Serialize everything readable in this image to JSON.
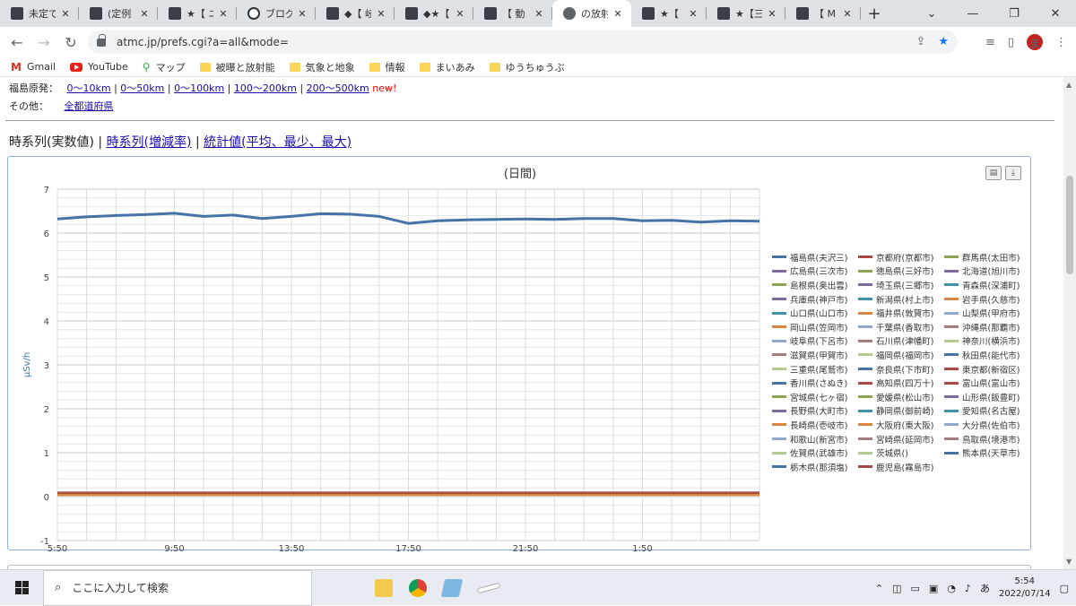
{
  "browser": {
    "tabs": [
      {
        "title": "未定で",
        "icon": "site-favicon"
      },
      {
        "title": "(定例",
        "icon": "site-favicon"
      },
      {
        "title": "★【 ニ",
        "icon": "site-favicon"
      },
      {
        "title": "ブログ記",
        "icon": "info-icon"
      },
      {
        "title": "◆【 岐",
        "icon": "site-favicon"
      },
      {
        "title": "◆★【",
        "icon": "site-favicon"
      },
      {
        "title": "【 動",
        "icon": "site-favicon"
      },
      {
        "title": "の放射",
        "icon": "globe-icon",
        "active": true
      },
      {
        "title": "★【 ",
        "icon": "site-favicon"
      },
      {
        "title": "★【三",
        "icon": "site-favicon"
      },
      {
        "title": "【 M",
        "icon": "site-favicon"
      }
    ],
    "new_tab": "+",
    "url": "atmc.jp/prefs.cgi?a=all&mode=",
    "avatar_letter": "ま",
    "bookmarks": [
      {
        "label": "Gmail",
        "icon": "gmail-icon"
      },
      {
        "label": "YouTube",
        "icon": "youtube-icon"
      },
      {
        "label": "マップ",
        "icon": "maps-icon"
      },
      {
        "label": "被曝と放射能",
        "icon": "folder-icon"
      },
      {
        "label": "気象と地象",
        "icon": "folder-icon"
      },
      {
        "label": "情報",
        "icon": "folder-icon"
      },
      {
        "label": "まいあみ",
        "icon": "folder-icon"
      },
      {
        "label": "ゆうちゅうぶ",
        "icon": "folder-icon"
      }
    ]
  },
  "page": {
    "fukushima_label": "福島原発：",
    "distance_links": [
      "0〜10km",
      "0〜50km",
      "0〜100km",
      "100〜200km",
      "200〜500km"
    ],
    "new_badge": "new!",
    "other_label": "その他：",
    "all_prefs_link": "全都道府県",
    "view_current": "時系列(実数値)",
    "view_links": [
      "時系列(増減率)",
      "統計値(平均、最少、最大)"
    ],
    "separator": "|"
  },
  "chart_data": {
    "type": "line",
    "title": "(日間)",
    "ylabel": "μSv/h",
    "ylim": [
      -1,
      7
    ],
    "yticks": [
      -1,
      0,
      1,
      2,
      3,
      4,
      5,
      6,
      7
    ],
    "xtick_labels": [
      "5:50",
      "9:50",
      "13:50",
      "17:50",
      "21:50",
      "1:50"
    ],
    "x": [
      "5:50",
      "6:50",
      "7:50",
      "8:50",
      "9:50",
      "10:50",
      "11:50",
      "12:50",
      "13:50",
      "14:50",
      "15:50",
      "16:50",
      "17:50",
      "18:50",
      "19:50",
      "20:50",
      "21:50",
      "22:50",
      "23:50",
      "0:50",
      "1:50",
      "2:50",
      "3:50",
      "4:50",
      "5:30"
    ],
    "series": [
      {
        "name": "福島県(夫沢三)",
        "color": "#4572a7",
        "values": [
          6.32,
          6.37,
          6.4,
          6.42,
          6.45,
          6.38,
          6.41,
          6.33,
          6.38,
          6.44,
          6.43,
          6.38,
          6.22,
          6.28,
          6.3,
          6.31,
          6.32,
          6.31,
          6.33,
          6.33,
          6.28,
          6.29,
          6.25,
          6.28,
          6.27
        ]
      },
      {
        "name": "京都府(京都市)",
        "color": "#aa4643",
        "values": [
          0.05,
          0.05,
          0.05,
          0.05,
          0.05,
          0.05,
          0.05,
          0.05,
          0.05,
          0.05,
          0.05,
          0.05,
          0.05,
          0.05,
          0.05,
          0.05,
          0.05,
          0.05,
          0.05,
          0.05,
          0.05,
          0.05,
          0.05,
          0.05,
          0.05
        ]
      },
      {
        "name": "群馬県(太田市)",
        "color": "#89a54e",
        "values": [
          0.06,
          0.06,
          0.06,
          0.06,
          0.06,
          0.06,
          0.06,
          0.06,
          0.06,
          0.06,
          0.06,
          0.06,
          0.06,
          0.06,
          0.06,
          0.06,
          0.06,
          0.06,
          0.06,
          0.06,
          0.06,
          0.06,
          0.06,
          0.06,
          0.06
        ]
      },
      {
        "name": "広島県(三次市)",
        "color": "#80699b",
        "values": [
          0.07,
          0.07,
          0.07,
          0.07,
          0.07,
          0.07,
          0.07,
          0.07,
          0.07,
          0.07,
          0.07,
          0.07,
          0.07,
          0.07,
          0.07,
          0.07,
          0.07,
          0.07,
          0.07,
          0.07,
          0.07,
          0.07,
          0.07,
          0.07,
          0.07
        ]
      },
      {
        "name": "徳島県(三好市)",
        "color": "#3d96ae",
        "values": [
          0.08,
          0.08,
          0.08,
          0.08,
          0.08,
          0.08,
          0.08,
          0.08,
          0.08,
          0.08,
          0.08,
          0.08,
          0.08,
          0.08,
          0.08,
          0.08,
          0.08,
          0.08,
          0.08,
          0.08,
          0.08,
          0.08,
          0.08,
          0.08,
          0.08
        ]
      },
      {
        "name": "北海道(旭川市)",
        "color": "#db843d",
        "values": [
          0.04,
          0.04,
          0.04,
          0.04,
          0.04,
          0.04,
          0.04,
          0.04,
          0.04,
          0.04,
          0.04,
          0.04,
          0.04,
          0.04,
          0.04,
          0.04,
          0.04,
          0.04,
          0.04,
          0.04,
          0.04,
          0.04,
          0.04,
          0.04,
          0.04
        ]
      },
      {
        "name": "鹿児島(霧島市)",
        "color": "#a74b3c",
        "values": [
          0.09,
          0.09,
          0.09,
          0.09,
          0.09,
          0.09,
          0.09,
          0.09,
          0.09,
          0.09,
          0.09,
          0.09,
          0.09,
          0.09,
          0.09,
          0.09,
          0.09,
          0.09,
          0.09,
          0.09,
          0.09,
          0.09,
          0.09,
          0.09,
          0.09
        ]
      }
    ],
    "legend_entries": [
      {
        "name": "福島県(夫沢三)",
        "color": "#4572a7"
      },
      {
        "name": "京都府(京都市)",
        "color": "#aa4643"
      },
      {
        "name": "群馬県(太田市)",
        "color": "#89a54e"
      },
      {
        "name": "広島県(三次市)",
        "color": "#80699b"
      },
      {
        "name": "徳島県(三好市)",
        "color": "#89a54e"
      },
      {
        "name": "北海道(旭川市)",
        "color": "#80699b"
      },
      {
        "name": "島根県(奥出雲)",
        "color": "#89a54e"
      },
      {
        "name": "埼玉県(三郷市)",
        "color": "#80699b"
      },
      {
        "name": "青森県(深浦町)",
        "color": "#3d96ae"
      },
      {
        "name": "兵庫県(神戸市)",
        "color": "#80699b"
      },
      {
        "name": "新潟県(村上市)",
        "color": "#3d96ae"
      },
      {
        "name": "岩手県(久慈市)",
        "color": "#db843d"
      },
      {
        "name": "山口県(山口市)",
        "color": "#3d96ae"
      },
      {
        "name": "福井県(敦賀市)",
        "color": "#db843d"
      },
      {
        "name": "山梨県(甲府市)",
        "color": "#92a8cd"
      },
      {
        "name": "岡山県(笠岡市)",
        "color": "#db843d"
      },
      {
        "name": "千葉県(香取市)",
        "color": "#92a8cd"
      },
      {
        "name": "沖縄県(那覇市)",
        "color": "#a47d7c"
      },
      {
        "name": "岐阜県(下呂市)",
        "color": "#92a8cd"
      },
      {
        "name": "石川県(津幡町)",
        "color": "#a47d7c"
      },
      {
        "name": "神奈川(横浜市)",
        "color": "#b5ca92"
      },
      {
        "name": "滋賀県(甲賀市)",
        "color": "#a47d7c"
      },
      {
        "name": "福岡県(福岡市)",
        "color": "#b5ca92"
      },
      {
        "name": "秋田県(能代市)",
        "color": "#4572a7"
      },
      {
        "name": "三重県(尾鷲市)",
        "color": "#b5ca92"
      },
      {
        "name": "奈良県(下市町)",
        "color": "#4572a7"
      },
      {
        "name": "東京都(新宿区)",
        "color": "#aa4643"
      },
      {
        "name": "香川県(さぬき)",
        "color": "#4572a7"
      },
      {
        "name": "高知県(四万十)",
        "color": "#aa4643"
      },
      {
        "name": "富山県(富山市)",
        "color": "#aa4643"
      },
      {
        "name": "宮城県(七ヶ宿)",
        "color": "#89a54e"
      },
      {
        "name": "愛媛県(松山市)",
        "color": "#89a54e"
      },
      {
        "name": "山形県(飯豊町)",
        "color": "#80699b"
      },
      {
        "name": "長野県(大町市)",
        "color": "#80699b"
      },
      {
        "name": "静岡県(御前崎)",
        "color": "#3d96ae"
      },
      {
        "name": "愛知県(名古屋)",
        "color": "#3d96ae"
      },
      {
        "name": "長崎県(壱岐市)",
        "color": "#db843d"
      },
      {
        "name": "大阪府(東大阪)",
        "color": "#db843d"
      },
      {
        "name": "大分県(佐伯市)",
        "color": "#92a8cd"
      },
      {
        "name": "和歌山(新宮市)",
        "color": "#92a8cd"
      },
      {
        "name": "宮崎県(延岡市)",
        "color": "#a47d7c"
      },
      {
        "name": "鳥取県(境港市)",
        "color": "#a47d7c"
      },
      {
        "name": "佐賀県(武雄市)",
        "color": "#b5ca92"
      },
      {
        "name": "茨城県()",
        "color": "#b5ca92"
      },
      {
        "name": "熊本県(天草市)",
        "color": "#4572a7"
      },
      {
        "name": "栃木県(那須塩)",
        "color": "#4572a7"
      },
      {
        "name": "鹿児島(霧島市)",
        "color": "#aa4643"
      }
    ],
    "legend_columns": 3,
    "legend_placement": "right",
    "grid": true
  },
  "taskbar": {
    "search_placeholder": "ここに入力して検索",
    "time": "5:54",
    "date": "2022/07/14",
    "ime": "あ"
  }
}
